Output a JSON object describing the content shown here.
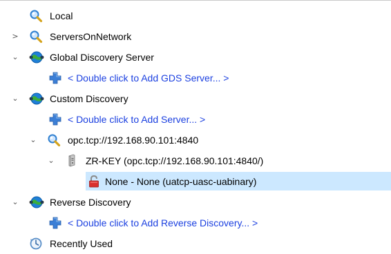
{
  "tree": {
    "local": {
      "label": "Local",
      "icon": "magnifier-icon"
    },
    "servers_on_network": {
      "label": "ServersOnNetwork",
      "icon": "magnifier-icon",
      "expander": "collapsed"
    },
    "global_discovery_server": {
      "label": "Global Discovery Server",
      "icon": "network-globe-icon",
      "expander": "expanded",
      "add_label": "< Double click to Add GDS Server... >"
    },
    "custom_discovery": {
      "label": "Custom Discovery",
      "icon": "network-globe-icon",
      "expander": "expanded",
      "add_label": "< Double click to Add Server... >",
      "endpoint": {
        "label": "opc.tcp://192.168.90.101:4840",
        "icon": "magnifier-icon",
        "expander": "expanded",
        "server": {
          "label": "ZR-KEY (opc.tcp://192.168.90.101:4840/)",
          "icon": "server-icon",
          "expander": "expanded",
          "security": {
            "label": "None - None (uatcp-uasc-uabinary)",
            "icon": "lock-icon",
            "selected": true
          }
        }
      }
    },
    "reverse_discovery": {
      "label": "Reverse Discovery",
      "icon": "network-globe-icon",
      "expander": "expanded",
      "add_label": "< Double click to Add Reverse Discovery... >"
    },
    "recently_used": {
      "label": "Recently Used",
      "icon": "history-icon"
    }
  },
  "colors": {
    "link": "#1a3fe0",
    "selection": "#cce8ff",
    "plus_icon": "#3c7fd6",
    "globe": "#1f7fd8",
    "lock_red": "#d9302e"
  }
}
